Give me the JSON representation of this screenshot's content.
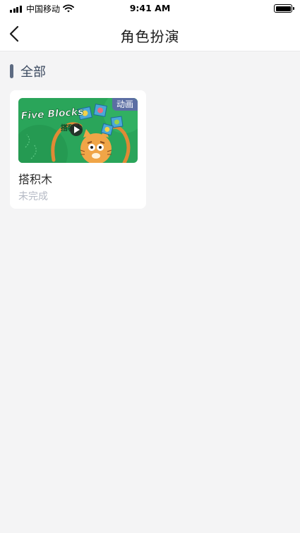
{
  "status_bar": {
    "carrier": "中国移动",
    "time": "9:41 AM"
  },
  "nav": {
    "title": "角色扮演"
  },
  "section": {
    "title": "全部"
  },
  "items": [
    {
      "title": "搭积木",
      "status": "未完成",
      "badge": "动画",
      "thumbnail_title_en": "Five Blocks",
      "thumbnail_title_cn": "搭积木"
    }
  ],
  "colors": {
    "background": "#f4f4f5",
    "section_accent": "#5d6b82",
    "badge": "#5b6ea3",
    "status_text": "#b4b9c4",
    "thumbnail_green": "#2aa55a"
  }
}
